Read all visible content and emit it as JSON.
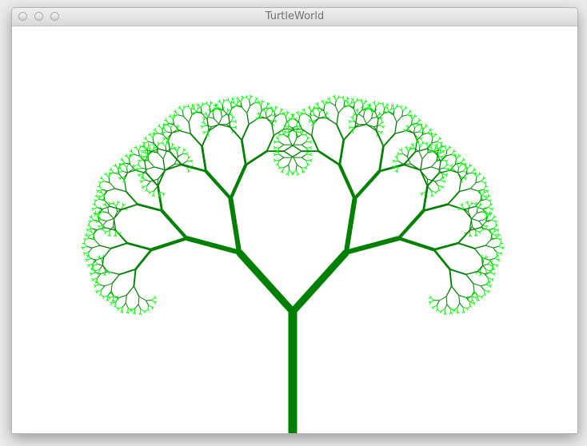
{
  "window": {
    "title": "TurtleWorld",
    "buttons": [
      "close",
      "minimize",
      "zoom"
    ]
  },
  "canvas": {
    "background": "#ffffff",
    "trunk_color": "#008000",
    "leaf_color": "#00ff00",
    "icon": "fractal-tree"
  }
}
